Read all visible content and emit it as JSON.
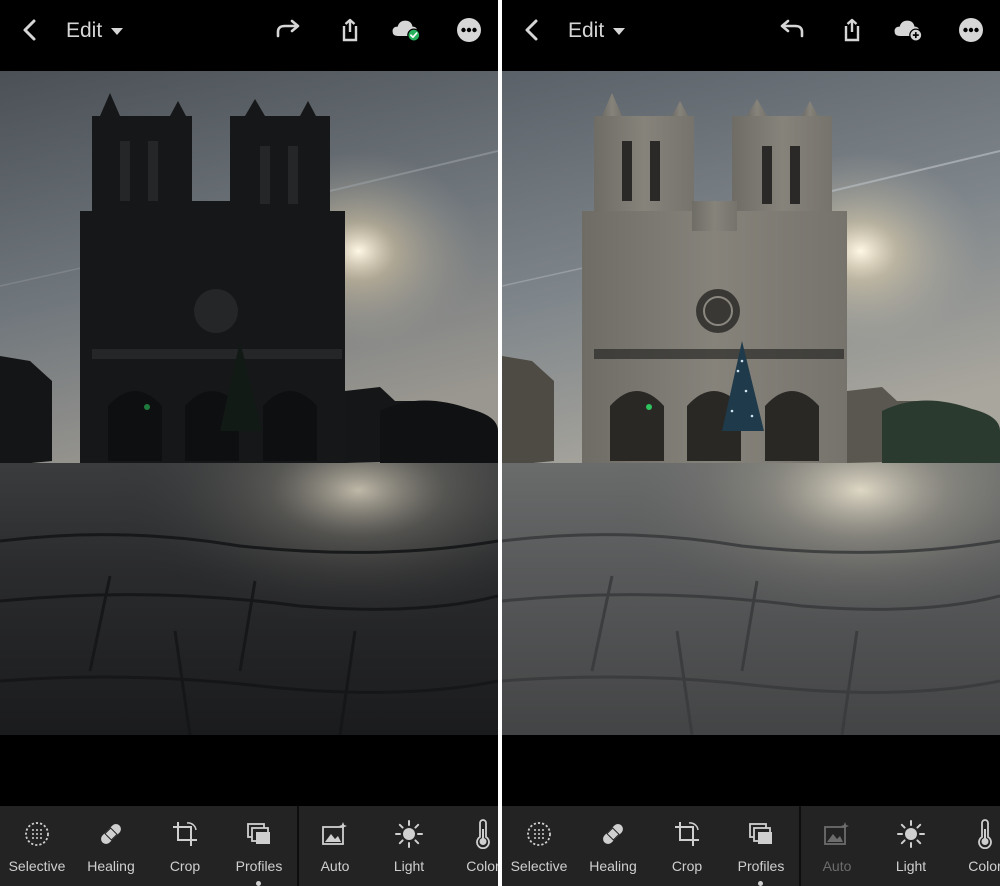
{
  "colors": {
    "toolbar_bg": "#232323",
    "icon_light": "#d6d6d6",
    "synced_badge": "#27b15c",
    "disabled": "#6c6c6c"
  },
  "panels": [
    {
      "id": "left",
      "header": {
        "edit_label": "Edit",
        "history_icon": "redo-icon",
        "cloud_state": "cloud-synced-icon"
      },
      "photo_state": "before-edit",
      "tools": [
        {
          "label": "Selective",
          "icon": "selective-icon"
        },
        {
          "label": "Healing",
          "icon": "healing-bandage-icon"
        },
        {
          "label": "Crop",
          "icon": "crop-icon"
        },
        {
          "label": "Profiles",
          "icon": "profiles-icon"
        },
        {
          "label": "Auto",
          "icon": "auto-enhance-icon"
        },
        {
          "label": "Light",
          "icon": "light-sun-icon"
        },
        {
          "label": "Color",
          "icon": "color-thermometer-icon"
        }
      ]
    },
    {
      "id": "right",
      "header": {
        "edit_label": "Edit",
        "history_icon": "undo-icon",
        "cloud_state": "cloud-add-icon"
      },
      "photo_state": "after-edit",
      "tools": [
        {
          "label": "Selective",
          "icon": "selective-icon"
        },
        {
          "label": "Healing",
          "icon": "healing-bandage-icon"
        },
        {
          "label": "Crop",
          "icon": "crop-icon"
        },
        {
          "label": "Profiles",
          "icon": "profiles-icon"
        },
        {
          "label": "Auto",
          "icon": "auto-enhance-icon",
          "disabled": true
        },
        {
          "label": "Light",
          "icon": "light-sun-icon"
        },
        {
          "label": "Color",
          "icon": "color-thermometer-icon"
        }
      ]
    }
  ]
}
